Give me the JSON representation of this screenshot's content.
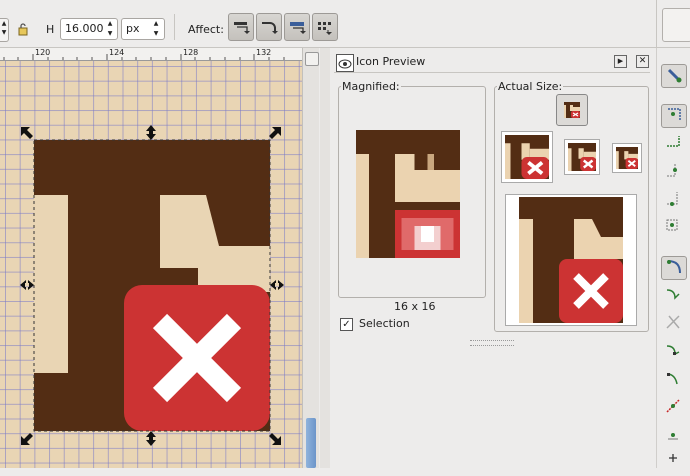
{
  "toolbar": {
    "h_label": "H",
    "h_value": "16.000",
    "unit_value": "px",
    "affect_label": "Affect:"
  },
  "ruler": {
    "ticks": [
      "120",
      "124",
      "128",
      "132"
    ]
  },
  "icon_preview": {
    "title": "Icon Preview",
    "magnified_label": "Magnified:",
    "actual_size_label": "Actual Size:",
    "size_caption": "16 x 16",
    "selection_label": "Selection",
    "selection_checked": true
  },
  "colors": {
    "dark_brown": "#532d14",
    "beige": "#ebd3b0",
    "red": "#cc3333",
    "white": "#ffffff"
  },
  "icons": {
    "lock": "lock-icon",
    "affect": [
      "scale-stroke-icon",
      "scale-corners-icon",
      "move-gradients-icon",
      "move-patterns-icon"
    ],
    "right_toolbar": [
      "snap-toggle-icon",
      "snap-bbox-icon",
      "snap-edge-icon",
      "snap-bbox-corner-icon",
      "snap-midpoint-icon",
      "snap-center-icon",
      "snap-nodes-icon",
      "snap-path-icon",
      "snap-intersection-icon",
      "snap-cusp-icon",
      "snap-smooth-icon",
      "snap-line-midpoint-icon",
      "snap-object-center-icon",
      "snap-rotation-center-icon"
    ]
  }
}
